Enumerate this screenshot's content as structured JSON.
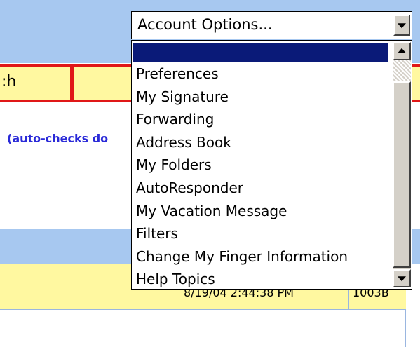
{
  "select": {
    "value": "Account Options...",
    "options": [
      "Preferences",
      "My Signature",
      "Forwarding",
      "Address Book",
      "My Folders",
      "AutoResponder",
      "My Vacation Message",
      "Filters",
      "Change My Finger Information",
      "Help Topics"
    ]
  },
  "page": {
    "nav_fragment": ":h",
    "autocheck_text": "(auto-checks do",
    "row_date": "8/19/04 2:44:38 PM",
    "row_size": "1003B"
  },
  "colors": {
    "band_blue": "#a7c8f0",
    "row_yellow": "#fff8a0",
    "nav_red": "#e01818",
    "highlight_navy": "#0a1a78",
    "link_blue": "#2a2ad8"
  }
}
